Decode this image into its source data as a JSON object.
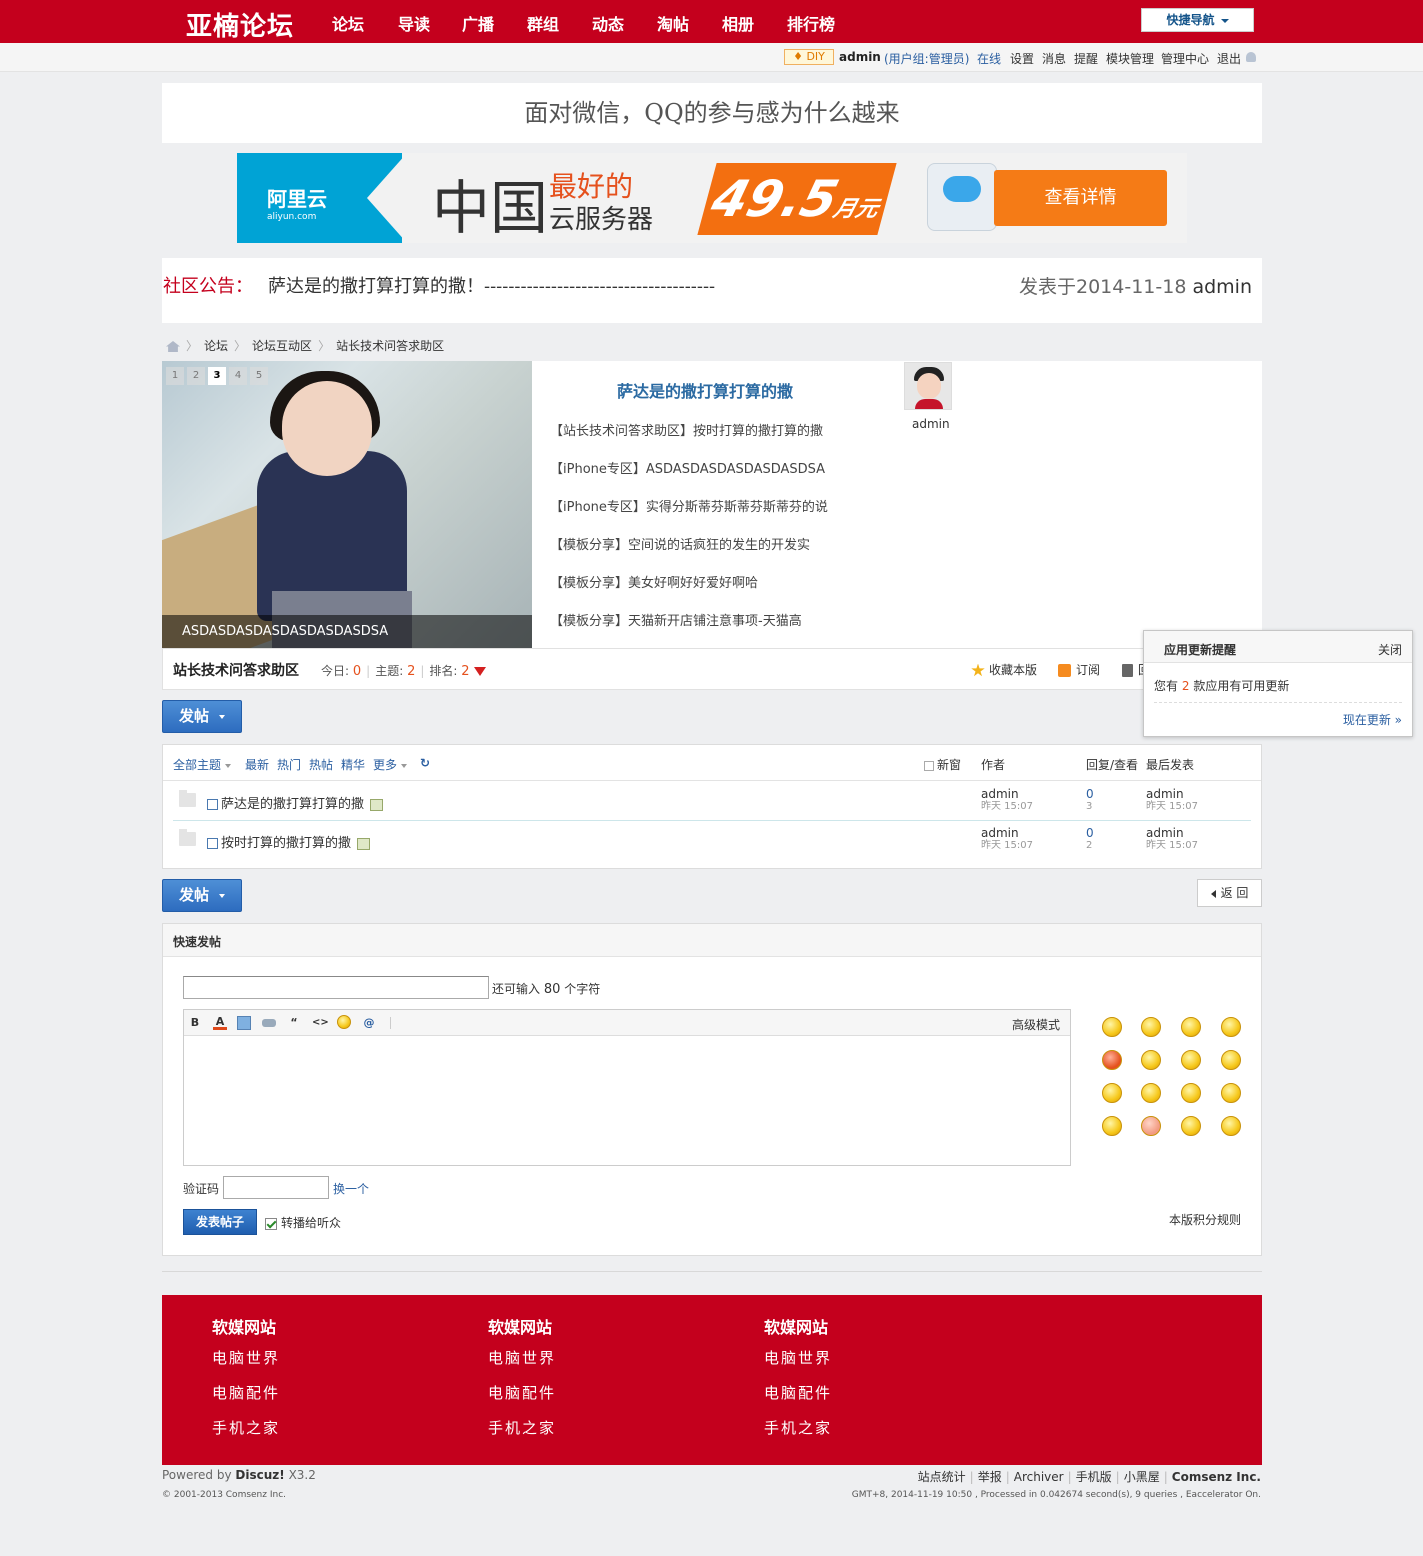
{
  "site": {
    "logo": "亚楠论坛",
    "brand_color": "#c4001d"
  },
  "nav": {
    "items": [
      "论坛",
      "导读",
      "广播",
      "群组",
      "动态",
      "淘帖",
      "相册",
      "排行榜"
    ],
    "quick_nav": "快捷导航"
  },
  "userbar": {
    "diy": "DIY",
    "username": "admin",
    "group": "(用户组:管理员)",
    "status": "在线",
    "links": [
      "设置",
      "消息",
      "提醒",
      "模块管理",
      "管理中心",
      "退出"
    ]
  },
  "headline": "面对微信，QQ的参与感为什么越来",
  "ad": {
    "logo": "阿里云",
    "logo_sub": "aliyun.com",
    "big": "中国",
    "best": "最好的",
    "cloud": "云服务器",
    "price": "49.5",
    "unit": "元",
    "per": "月",
    "button": "查看详情"
  },
  "announcement": {
    "label": "社区公告：",
    "text": "萨达是的撒打算打算的撒！--------------------------------------",
    "meta_prefix": "发表于2014-11-18",
    "author": "admin"
  },
  "breadcrumb": [
    "论坛",
    "论坛互动区",
    "站长技术问答求助区"
  ],
  "feature": {
    "pages": [
      "1",
      "2",
      "3",
      "4",
      "5"
    ],
    "active_page": "3",
    "caption": "ASDASDASDASDASDASDASDSA",
    "title": "萨达是的撒打算打算的撒",
    "items": [
      "【站长技术问答求助区】按时打算的撒打算的撒",
      "【iPhone专区】ASDASDASDASDASDASDSA",
      "【iPhone专区】实得分斯蒂芬斯蒂芬斯蒂芬的说",
      "【模板分享】空间说的话疯狂的发生的开发实",
      "【模板分享】美女好啊好好爱好啊哈",
      "【模板分享】天猫新开店铺注意事项-天猫高"
    ],
    "avatar_name": "admin"
  },
  "forum": {
    "name": "站长技术问答求助区",
    "today_label": "今日:",
    "today": "0",
    "topics_label": "主题:",
    "topics": "2",
    "rank_label": "排名:",
    "rank": "2",
    "favorite": "收藏本版",
    "subscribe": "订阅",
    "recycle": "回"
  },
  "buttons": {
    "post": "发帖",
    "back": "返 回"
  },
  "threadlist": {
    "filters": [
      "全部主题",
      "最新",
      "热门",
      "热帖",
      "精华",
      "更多"
    ],
    "new_window": "新窗",
    "col_author": "作者",
    "col_replies": "回复/查看",
    "col_last": "最后发表",
    "rows": [
      {
        "title": "萨达是的撒打算打算的撒",
        "author": "admin",
        "time": "昨天 15:07",
        "replies": "0",
        "views": "3",
        "last_author": "admin",
        "last_time": "昨天 15:07"
      },
      {
        "title": "按时打算的撒打算的撒",
        "author": "admin",
        "time": "昨天 15:07",
        "replies": "0",
        "views": "2",
        "last_author": "admin",
        "last_time": "昨天 15:07"
      }
    ]
  },
  "quickpost": {
    "title": "快速发帖",
    "remain_prefix": "还可输入",
    "remain_count": "80",
    "remain_suffix": "个字符",
    "advanced": "高级模式",
    "toolbar": [
      "B",
      "A",
      "image-icon",
      "link-icon",
      "“",
      "<>",
      "emoji-icon",
      "@"
    ],
    "captcha_label": "验证码",
    "captcha_change": "换一个",
    "submit": "发表帖子",
    "share": "转播给听众",
    "rules": "本版积分规则"
  },
  "footer": {
    "columns": [
      {
        "title": "软媒网站",
        "links": [
          "电脑世界",
          "电脑配件",
          "手机之家"
        ]
      },
      {
        "title": "软媒网站",
        "links": [
          "电脑世界",
          "电脑配件",
          "手机之家"
        ]
      },
      {
        "title": "软媒网站",
        "links": [
          "电脑世界",
          "电脑配件",
          "手机之家"
        ]
      }
    ],
    "powered_prefix": "Powered by",
    "powered_brand": "Discuz!",
    "powered_version": "X3.2",
    "copyright": "© 2001-2013 Comsenz Inc.",
    "links": [
      "站点统计",
      "举报",
      "Archiver",
      "手机版",
      "小黑屋"
    ],
    "company": "Comsenz Inc.",
    "gmt": "GMT+8, 2014-11-19 10:50 , Processed in 0.042674 second(s), 9 queries , Eaccelerator On."
  },
  "popup": {
    "title": "应用更新提醒",
    "close": "关闭",
    "msg_prefix": "您有",
    "count": "2",
    "msg_suffix": "款应用有可用更新",
    "update": "现在更新 »"
  }
}
